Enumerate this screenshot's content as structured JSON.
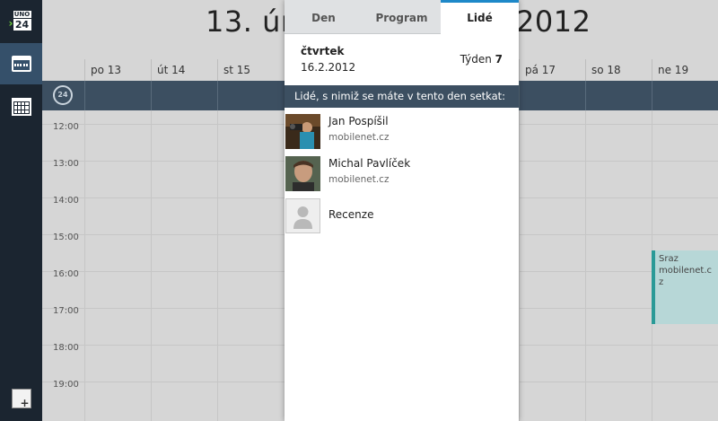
{
  "sidebar": {
    "today_icon_top": "ÚNO",
    "today_icon_num": "24",
    "buttons": [
      "today-button",
      "week-view-button",
      "month-view-button",
      "add-event-button"
    ]
  },
  "calendar": {
    "title_left": "13. ún",
    "title_right": "2012",
    "timezone_badge": "24",
    "days": [
      "po 13",
      "út 14",
      "st 15",
      "pá 17",
      "so 18",
      "ne 19"
    ],
    "hours": [
      "12:00",
      "13:00",
      "14:00",
      "15:00",
      "16:00",
      "17:00",
      "18:00",
      "19:00"
    ],
    "event": {
      "line1": "Sraz",
      "line2": "mobilenet.c",
      "line3": "z"
    }
  },
  "panel": {
    "tabs": [
      {
        "label": "Den",
        "active": false
      },
      {
        "label": "Program",
        "active": false
      },
      {
        "label": "Lidé",
        "active": true
      }
    ],
    "day_name": "čtvrtek",
    "date": "16.2.2012",
    "week_prefix": "Týden",
    "week_number": "7",
    "people_header": "Lidé, s nimiž se máte v tento den setkat:",
    "people": [
      {
        "name": "Jan Pospíšil",
        "detail": "mobilenet.cz"
      },
      {
        "name": "Michal Pavlíček",
        "detail": "mobilenet.cz"
      },
      {
        "name": "Recenze",
        "detail": ""
      }
    ]
  },
  "colors": {
    "sidebar_bg": "#1b2530",
    "header_bar": "#3c4f61",
    "tab_accent": "#1e88c8",
    "event_bg": "#b7d7d7",
    "event_border": "#2a9a97"
  }
}
